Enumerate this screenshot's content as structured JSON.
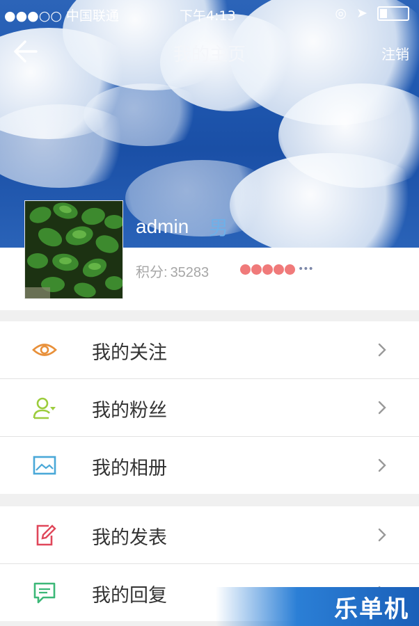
{
  "status_bar": {
    "carrier": "●●●○○ 中国联通",
    "time": "下午4:13"
  },
  "nav": {
    "title": "我的主页",
    "logout": "注销"
  },
  "profile": {
    "username": "admin",
    "gender": "男",
    "score_label": "积分:",
    "score_value": "35283",
    "level_dots": 5,
    "more": "•••"
  },
  "menu": {
    "group1": [
      {
        "label": "我的关注",
        "icon": "eye-icon",
        "color": "#e8903a"
      },
      {
        "label": "我的粉丝",
        "icon": "user-follow-icon",
        "color": "#9ccc3c"
      },
      {
        "label": "我的相册",
        "icon": "image-icon",
        "color": "#4aa8d8"
      }
    ],
    "group2": [
      {
        "label": "我的发表",
        "icon": "edit-icon",
        "color": "#e0475a"
      },
      {
        "label": "我的回复",
        "icon": "comment-icon",
        "color": "#3cb878"
      }
    ]
  },
  "watermark": "乐单机"
}
